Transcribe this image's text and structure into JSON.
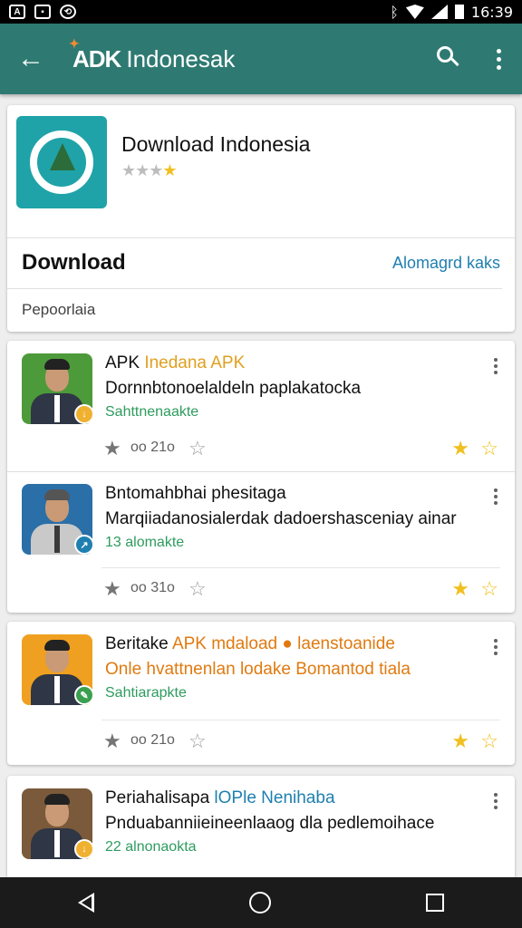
{
  "status_bar": {
    "time": "16:39",
    "left_icons": [
      "notification-icon",
      "photo-icon",
      "sync-icon"
    ],
    "right_icons": [
      "bluetooth-icon",
      "wifi-icon",
      "signal-icon",
      "battery-icon"
    ]
  },
  "app_bar": {
    "logo_text": "ADK",
    "title": "Indonesak",
    "back_icon": "arrow-left-icon",
    "search_icon": "search-icon",
    "more_icon": "more-vert-icon",
    "color": "#2e7a72"
  },
  "app_header": {
    "name": "Download  Indonesia",
    "rating_stars_grey": "★★★",
    "rating_stars_gold": "★",
    "download_label": "Download",
    "download_link": "Alomagrd kaks",
    "sub_label": "Pepoorlaia"
  },
  "items": [
    {
      "title_main": "APK ",
      "title_accent": "Inedana APK",
      "description": "Dornnbtonoelaldeln paplakatocka",
      "meta": "Sahttnenaakte",
      "count": "oo 21o",
      "badge_color": "#f0b030"
    },
    {
      "title_main": "Bntomahbhai phesitaga",
      "title_accent": "",
      "description": "Marqiiadanosialerdak dadoershasceniay ainar",
      "meta": "13 alomakte",
      "count": "oo 31o",
      "badge_color": "#1f7fb0"
    },
    {
      "title_main": "Beritake ",
      "title_accent": "APK mdaload ● laenstoanide",
      "description": "Onle hvattnenlan lodake Bomantod tiala",
      "meta": "Sahtiarapkte",
      "count": "oo 21o",
      "badge_color": "#3aa050"
    },
    {
      "title_main": "Periahalisapa ",
      "title_accent": "lOPle Nenihaba",
      "description": "Pnduabanniieineenlaaog dla pedlemoihace",
      "meta": "22 alnonaokta",
      "count": "",
      "badge_color": "#f0b030"
    }
  ],
  "colors": {
    "accent_gold": "#f0c020",
    "link_blue": "#1f7fb0",
    "meta_green": "#2e9b5e"
  },
  "nav_bar": {
    "back_icon": "nav-back-icon",
    "home_icon": "nav-home-icon",
    "recents_icon": "nav-recents-icon"
  }
}
